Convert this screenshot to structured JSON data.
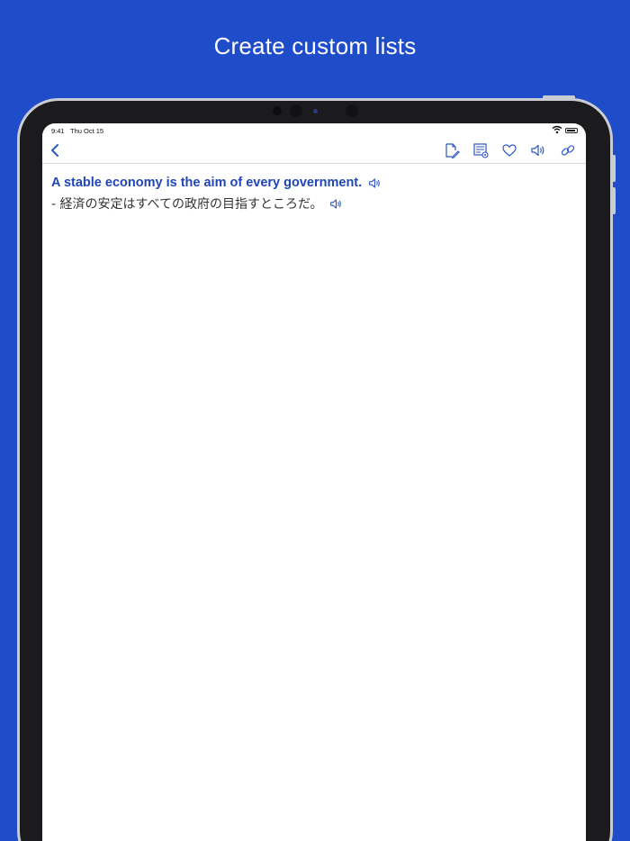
{
  "promo": {
    "headline": "Create custom lists"
  },
  "status_bar": {
    "time": "9:41",
    "date": "Thu Oct 15"
  },
  "toolbar": {
    "icons": [
      "chevron-left-icon",
      "edit-note-icon",
      "list-settings-icon",
      "heart-icon",
      "speaker-icon",
      "link-icon"
    ]
  },
  "entry": {
    "english": "A stable economy is the aim of every government.",
    "japanese": "- 経済の安定はすべての政府の目指すところだ。"
  },
  "colors": {
    "background": "#1f4cc9",
    "accent": "#1f46b8",
    "icon": "#2b56c6"
  }
}
